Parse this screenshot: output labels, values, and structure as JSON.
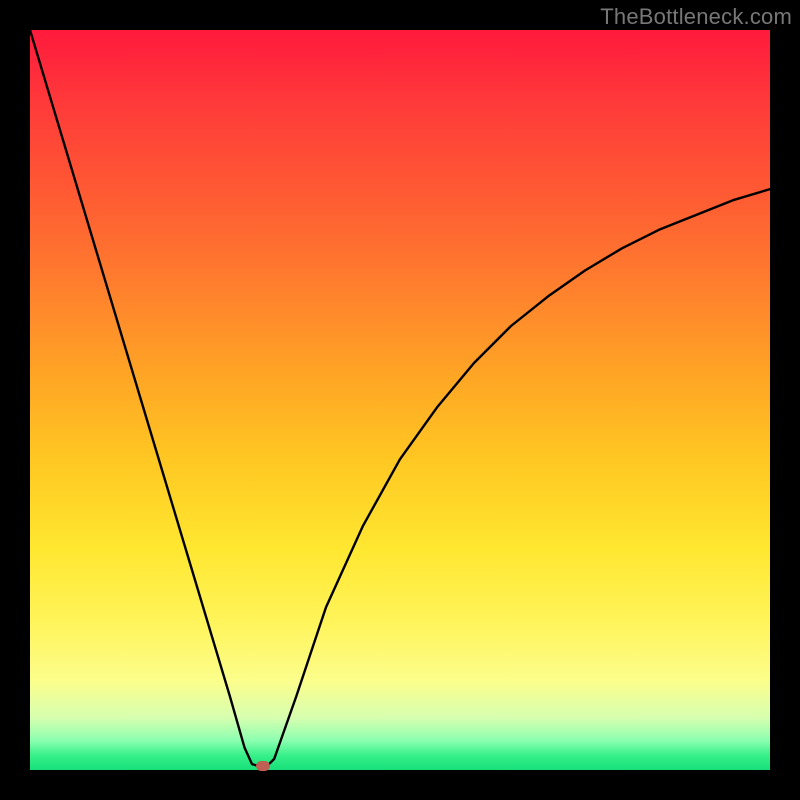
{
  "watermark": "TheBottleneck.com",
  "colors": {
    "frame": "#000000",
    "curve": "#000000",
    "marker": "#c06055"
  },
  "chart_data": {
    "type": "line",
    "title": "",
    "xlabel": "",
    "ylabel": "",
    "xlim": [
      0,
      100
    ],
    "ylim": [
      0,
      100
    ],
    "grid": false,
    "legend": false,
    "series": [
      {
        "name": "bottleneck-curve",
        "x": [
          0,
          3,
          6,
          9,
          12,
          15,
          18,
          21,
          24,
          27,
          29,
          30,
          31,
          32,
          33,
          36,
          40,
          45,
          50,
          55,
          60,
          65,
          70,
          75,
          80,
          85,
          90,
          95,
          100
        ],
        "y": [
          100,
          90,
          80,
          70,
          60,
          50,
          40,
          30,
          20,
          10,
          3,
          0.8,
          0.5,
          0.5,
          1.5,
          10,
          22,
          33,
          42,
          49,
          55,
          60,
          64,
          67.5,
          70.5,
          73,
          75,
          77,
          78.5
        ]
      }
    ],
    "marker": {
      "x": 31.5,
      "y": 0.5
    },
    "gradient_background": {
      "top": "#ff1a3c",
      "upper_mid": "#ffa325",
      "lower_mid": "#fff45a",
      "bottom": "#16e07a"
    }
  }
}
